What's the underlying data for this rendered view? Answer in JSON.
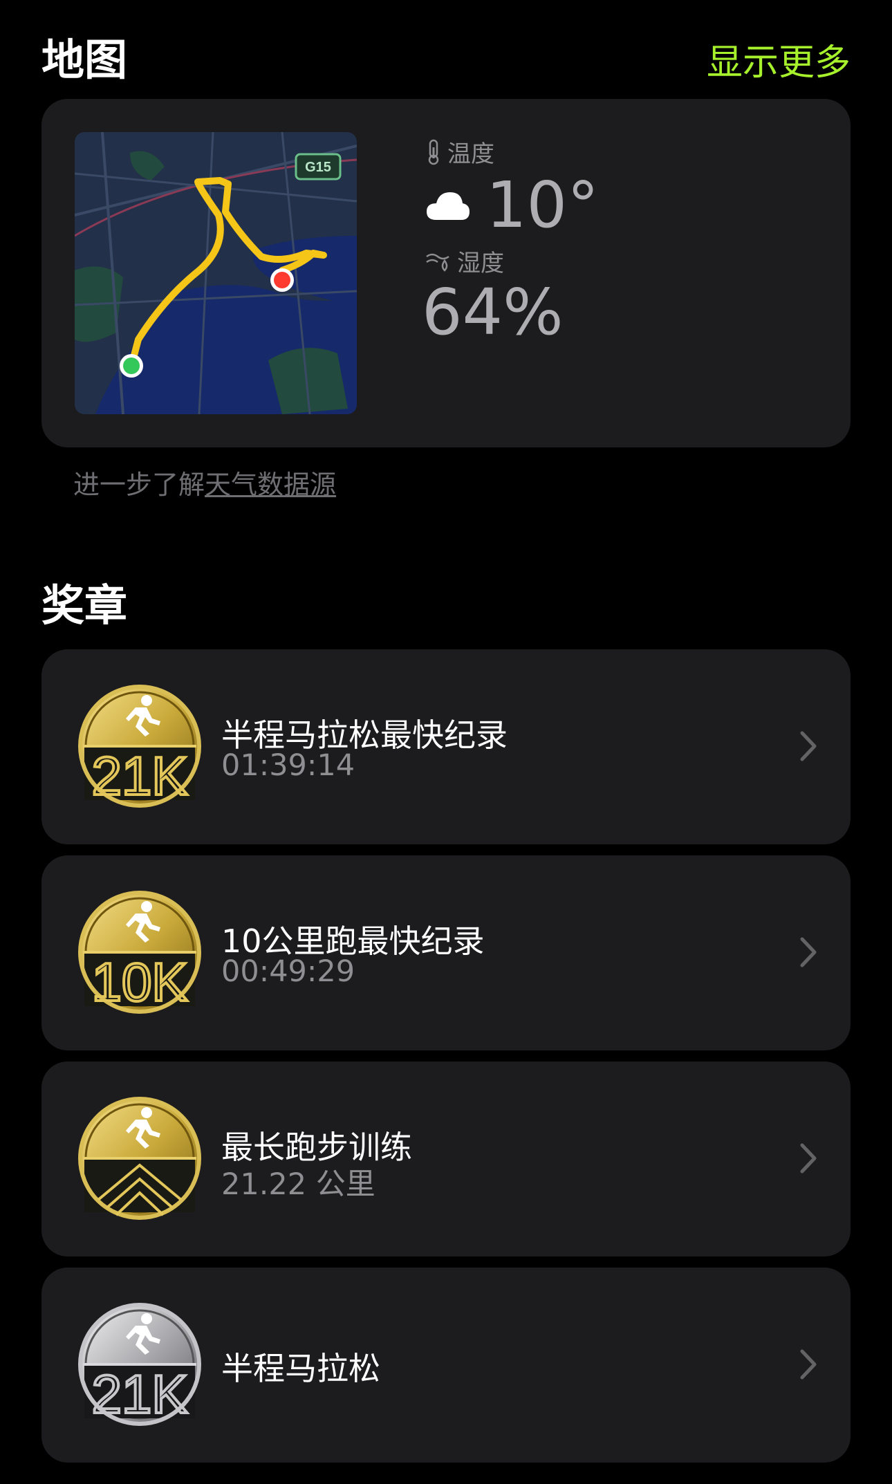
{
  "map_section": {
    "title": "地图",
    "show_more": "显示更多",
    "map_road_label": "G15",
    "temperature": {
      "label": "温度",
      "value": "10°",
      "icon": "cloud-icon"
    },
    "humidity": {
      "label": "湿度",
      "value": "64%",
      "icon": "humidity-icon"
    },
    "footnote_prefix": "进一步了解",
    "footnote_link": "天气数据源"
  },
  "awards_section": {
    "title": "奖章",
    "items": [
      {
        "title": "半程马拉松最快纪录",
        "value": "01:39:14",
        "medal": "gold-21k",
        "medal_text": "21K"
      },
      {
        "title": "10公里跑最快纪录",
        "value": "00:49:29",
        "medal": "gold-10k",
        "medal_text": "10K"
      },
      {
        "title": "最长跑步训练",
        "value": "21.22 公里",
        "medal": "gold-longest",
        "medal_text": ""
      },
      {
        "title": "半程马拉松",
        "value": "",
        "medal": "silver-21k",
        "medal_text": "21K"
      }
    ]
  },
  "colors": {
    "accent": "#a6f12b",
    "card_bg": "#1c1c1e",
    "route": "#f5c518",
    "start_dot": "#34c759",
    "end_dot": "#ff3b30",
    "gold": "#c9a93a",
    "silver": "#b8b8bc"
  }
}
